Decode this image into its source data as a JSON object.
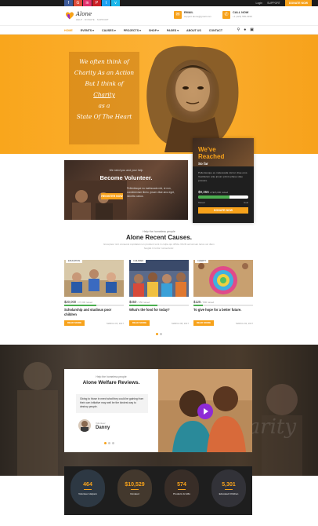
{
  "colors": {
    "accent": "#f7a21b",
    "dark": "#1c1c1c",
    "progress": "#4caf50",
    "play": "#8e2bd6"
  },
  "topbar": {
    "socials": [
      {
        "icon": "facebook-icon",
        "glyph": "f",
        "color": "#3b5998"
      },
      {
        "icon": "google-plus-icon",
        "glyph": "G",
        "color": "#dd4b39"
      },
      {
        "icon": "linkedin-icon",
        "glyph": "in",
        "color": "#e1306c"
      },
      {
        "icon": "pinterest-icon",
        "glyph": "P",
        "color": "#cb2027"
      },
      {
        "icon": "twitter-icon",
        "glyph": "t",
        "color": "#1da1f2"
      },
      {
        "icon": "vimeo-icon",
        "glyph": "v",
        "color": "#1ab7ea"
      }
    ],
    "login": "Login",
    "support": "SUPPORT",
    "donate": "DONATE NOW"
  },
  "header": {
    "logo_text": "Alone",
    "logo_tagline": "HELP · DONATE · SUPPORT",
    "email_label": "EMAIL",
    "email_value": "support.alone@gmail.com",
    "call_label": "CALL NOW",
    "call_value": "+1 (423) 555-0199"
  },
  "nav": {
    "items": [
      "HOME",
      "EVENTS",
      "CAUSES",
      "PROJECTS",
      "SHOP",
      "PAGES",
      "ABOUT US",
      "CONTACT"
    ],
    "active_index": 0
  },
  "hero": {
    "quote_lines": [
      "We often think of",
      "Charity As an Action",
      "But I think of",
      "Charity",
      "as a",
      "State Of The Heart"
    ]
  },
  "volunteer": {
    "small": "We need you and your help",
    "title": "Become Volunteer.",
    "button": "REGISTER NOW",
    "text": "Pellentesque eu malesuada nisi, ut non, condimentum libero, ipsum vitae arcu eget, lobortis cursus."
  },
  "reached": {
    "title": "We've Reached",
    "subtitle": "So far",
    "text": "Pellentesque eu malesuada nisi tur vitae eros. Vestibulum ante ipsum primis phase vitae posuere.",
    "amount": "$9,356",
    "amount_note": "of $15,000 raised",
    "progress": 0.62,
    "meta_left": "Raised",
    "meta_right": "Goal",
    "button": "DONATE NOW"
  },
  "causes": {
    "small": "Help the homeless people",
    "title": "Alone Recent Causes.",
    "description": "Excepteur sint occaecat cupidatat non proident sunt in culpa qui officia. Morbi accumsan lacus vel diam feugiat in tortor consectetur.",
    "items": [
      {
        "tag": "EDUCATION",
        "amount": "$20,000",
        "amount_note": "/ 37,000 raised",
        "progress": 0.54,
        "title": "Scholarship and studious poor children",
        "button": "READ MORE",
        "date": "MARCH 15, 2017"
      },
      {
        "tag": "CHILDREN",
        "amount": "$450",
        "amount_note": "/ 950 raised",
        "progress": 0.47,
        "title": "What's the food for today?",
        "button": "READ MORE",
        "date": "MARCH 08, 2017"
      },
      {
        "tag": "CHARITY",
        "amount": "$125",
        "amount_note": "/ 800 raised",
        "progress": 0.16,
        "title": "To give hope for a better future.",
        "button": "READ MORE",
        "date": "MARCH 02, 2017"
      }
    ]
  },
  "welfare": {
    "small": "Help the homeless people",
    "title": "Alone Welfare Reviews.",
    "quote": "Giving to those in need what they could be gaining from their own initiative may well be the kindest way to destroy people.",
    "role": "Volunteer",
    "name": "Danny"
  },
  "stats": [
    {
      "value": "464",
      "label": "Volunteer Helpers",
      "color": "#4a6a8a"
    },
    {
      "value": "$10,529",
      "label": "Donated",
      "color": "#8a6a4a"
    },
    {
      "value": "574",
      "label": "Products & Gifts",
      "color": "#6a4a3a"
    },
    {
      "value": "5,301",
      "label": "Educated Children",
      "color": "#5a5a6a"
    }
  ]
}
